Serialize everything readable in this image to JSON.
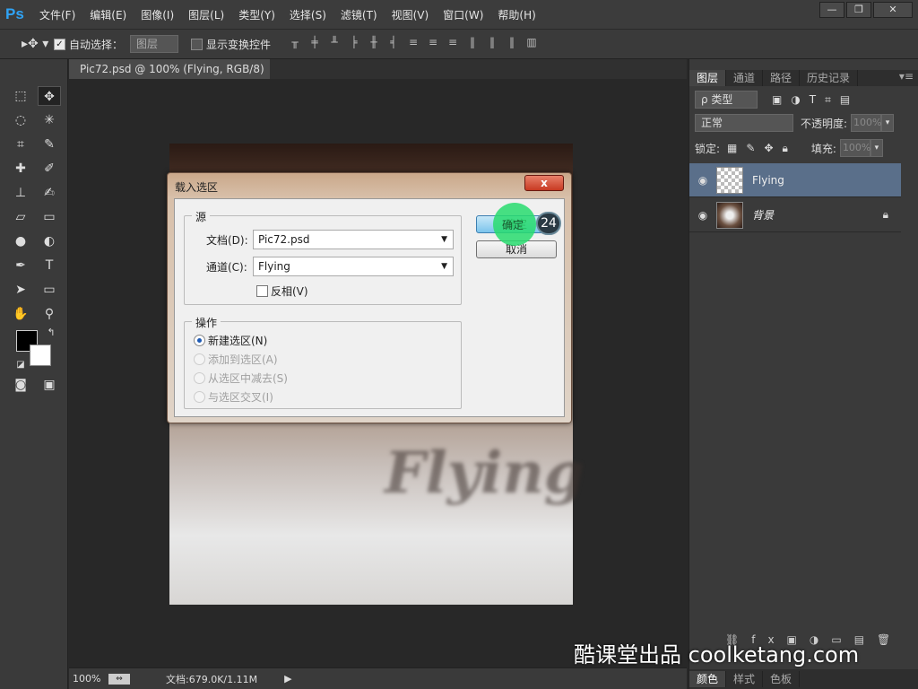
{
  "app": {
    "logo": "Ps"
  },
  "menu": [
    "文件(F)",
    "编辑(E)",
    "图像(I)",
    "图层(L)",
    "类型(Y)",
    "选择(S)",
    "滤镜(T)",
    "视图(V)",
    "窗口(W)",
    "帮助(H)"
  ],
  "window_buttons": {
    "minimize": "—",
    "restore": "❐",
    "close": "✕"
  },
  "options": {
    "auto_select_label": "自动选择：",
    "auto_select_value": "图层",
    "show_transform_label": "显示变换控件"
  },
  "document": {
    "tab_title": "Pic72.psd @ 100% (Flying, RGB/8) *",
    "tab_close": "×",
    "zoom": "100%",
    "doc_size": "文档:679.0K/1.11M"
  },
  "layers_panel": {
    "tabs": [
      "图层",
      "通道",
      "路径",
      "历史记录"
    ],
    "filter_label": "ρ 类型",
    "blend_mode": "正常",
    "opacity_label": "不透明度:",
    "opacity_value": "100%",
    "lock_label": "锁定:",
    "fill_label": "填充:",
    "fill_value": "100%",
    "layers": [
      {
        "name": "Flying",
        "selected": true,
        "locked": false
      },
      {
        "name": "背景",
        "selected": false,
        "locked": true
      }
    ],
    "bottom_tabs": [
      "颜色",
      "样式",
      "色板"
    ]
  },
  "dialog": {
    "title": "载入选区",
    "close_label": "x",
    "source_legend": "源",
    "document_label": "文档(D):",
    "document_value": "Pic72.psd",
    "channel_label": "通道(C):",
    "channel_value": "Flying",
    "invert_label": "反相(V)",
    "operation_legend": "操作",
    "operations": [
      {
        "label": "新建选区(N)",
        "selected": true,
        "enabled": true
      },
      {
        "label": "添加到选区(A)",
        "selected": false,
        "enabled": false
      },
      {
        "label": "从选区中减去(S)",
        "selected": false,
        "enabled": false
      },
      {
        "label": "与选区交叉(I)",
        "selected": false,
        "enabled": false
      }
    ],
    "ok_label": "确定",
    "cancel_label": "取消"
  },
  "tutorial": {
    "step": "24",
    "watermark": "酷课堂出品 coolketang.com"
  },
  "canvas_text": "Flying"
}
